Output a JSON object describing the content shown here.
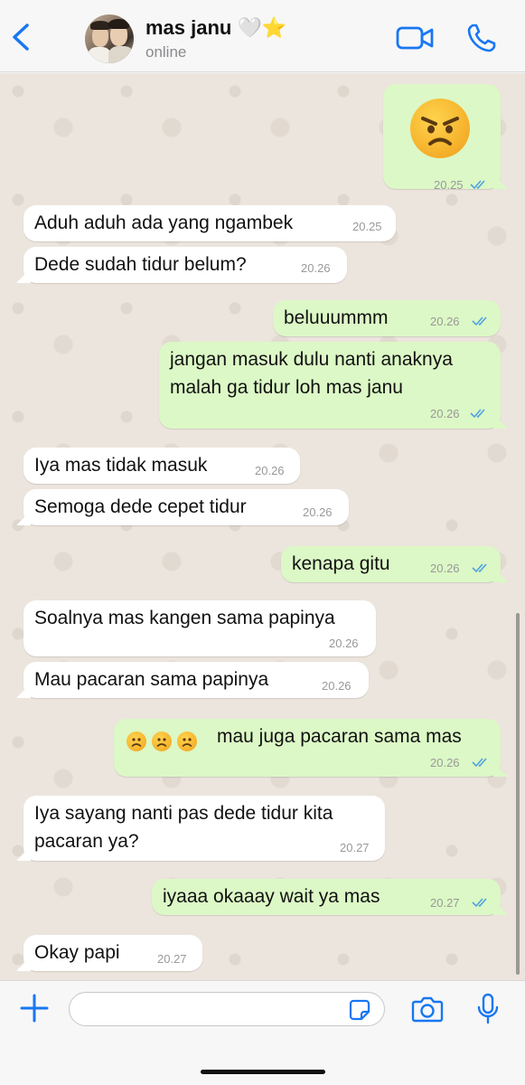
{
  "header": {
    "contact_name": "mas janu 🤍⭐",
    "status": "online",
    "accent_color": "#1877f2",
    "icons": [
      "chevron-left-icon",
      "avatar",
      "video-camera-icon",
      "phone-icon"
    ]
  },
  "messages": [
    {
      "direction": "outgoing",
      "emoji": "angry-face",
      "text": "😠",
      "time": "20.25",
      "read": true
    },
    {
      "direction": "incoming",
      "text": "Aduh aduh ada yang ngambek",
      "time": "20.25"
    },
    {
      "direction": "incoming",
      "text": "Dede sudah tidur belum?",
      "time": "20.26"
    },
    {
      "direction": "outgoing",
      "text": "beluuummm",
      "time": "20.26",
      "read": true
    },
    {
      "direction": "outgoing",
      "text": "jangan masuk dulu nanti anaknya\nmalah ga tidur loh mas janu",
      "time": "20.26",
      "read": true
    },
    {
      "direction": "incoming",
      "text": "Iya mas tidak masuk",
      "time": "20.26"
    },
    {
      "direction": "incoming",
      "text": "Semoga dede cepet tidur",
      "time": "20.26"
    },
    {
      "direction": "outgoing",
      "text": "kenapa gitu",
      "time": "20.26",
      "read": true
    },
    {
      "direction": "incoming",
      "text": "Soalnya mas kangen sama papinya",
      "time": "20.26"
    },
    {
      "direction": "incoming",
      "text": "Mau pacaran sama papinya",
      "time": "20.26"
    },
    {
      "direction": "outgoing",
      "emoji_prefix": "☹️☹️☹️",
      "text": "mau juga pacaran sama mas",
      "time": "20.26",
      "read": true
    },
    {
      "direction": "incoming",
      "text": "Iya sayang nanti pas dede tidur kita\npacaran ya?",
      "time": "20.27"
    },
    {
      "direction": "outgoing",
      "text": "iyaaa okaaay wait ya mas",
      "time": "20.27",
      "read": true
    },
    {
      "direction": "incoming",
      "text": "Okay papi",
      "time": "20.27"
    }
  ],
  "input": {
    "placeholder": "",
    "value": ""
  },
  "colors": {
    "outgoing_bubble": "#dcf8c6",
    "incoming_bubble": "#ffffff",
    "read_ticks": "#4fa3e0"
  }
}
